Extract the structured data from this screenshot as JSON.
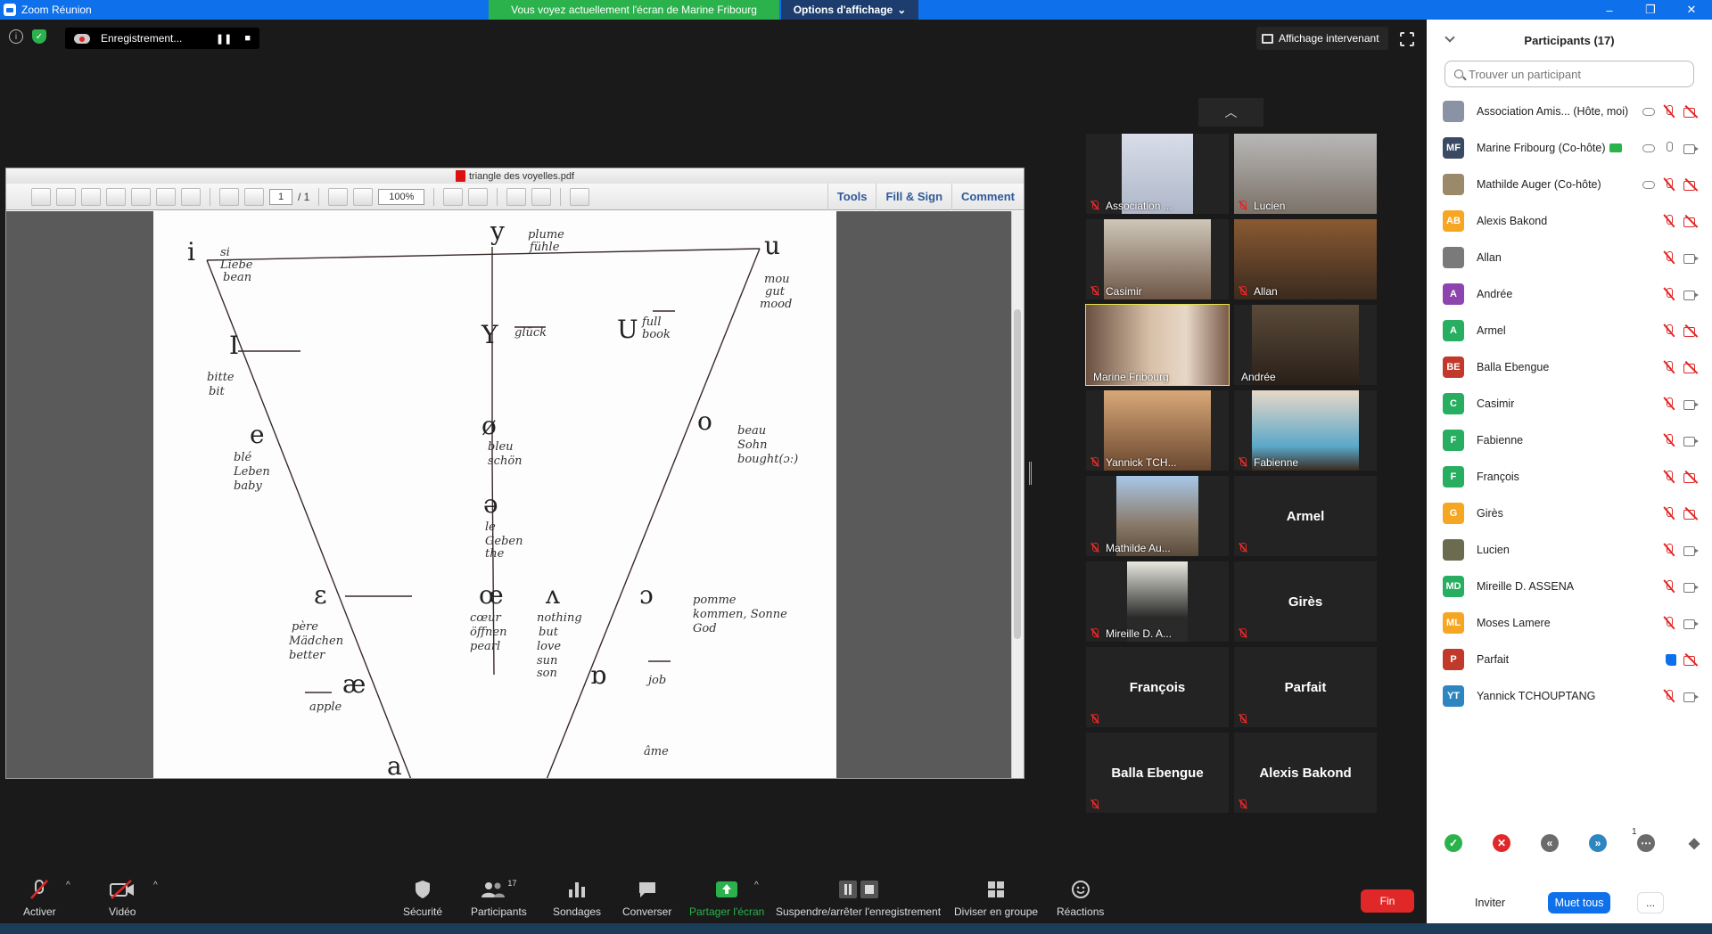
{
  "window": {
    "title": "Zoom Réunion",
    "share_banner": "Vous voyez actuellement l'écran de Marine Fribourg",
    "view_options": "Options d'affichage",
    "minimize": "–",
    "restore": "❐",
    "close": "✕"
  },
  "meeting_bar": {
    "recording_label": "Enregistrement...",
    "pause_glyph": "❚❚",
    "stop_glyph": "■",
    "speaker_view_label": "Affichage intervenant"
  },
  "pdf": {
    "filename": "triangle des voyelles.pdf",
    "page_current": "1",
    "page_total": "/ 1",
    "zoom": "100%",
    "tools": "Tools",
    "fill_sign": "Fill & Sign",
    "comment": "Comment"
  },
  "gallery": {
    "tiles": [
      {
        "name": "Association ..."
      },
      {
        "name": "Lucien"
      },
      {
        "name": "Casimir"
      },
      {
        "name": "Allan"
      },
      {
        "name": "Marine Fribourg"
      },
      {
        "name": "Andrée"
      },
      {
        "name": "Yannick TCH..."
      },
      {
        "name": "Fabienne"
      },
      {
        "name": "Mathilde Au..."
      },
      {
        "name": "Armel"
      },
      {
        "name": "Mireille D. A..."
      },
      {
        "name": "Girès"
      },
      {
        "name": "François"
      },
      {
        "name": "Parfait"
      },
      {
        "name": "Balla Ebengue"
      },
      {
        "name": "Alexis Bakond"
      }
    ]
  },
  "participants": {
    "title": "Participants (17)",
    "search_placeholder": "Trouver un participant",
    "list": [
      {
        "initials": "",
        "name": "Association Amis... (Hôte, moi)",
        "color": "#8a93a6"
      },
      {
        "initials": "MF",
        "name": "Marine Fribourg (Co-hôte)",
        "color": "#3b4a63"
      },
      {
        "initials": "",
        "name": "Mathilde Auger (Co-hôte)",
        "color": "#9a8a6a"
      },
      {
        "initials": "AB",
        "name": "Alexis Bakond",
        "color": "#f5a623"
      },
      {
        "initials": "",
        "name": "Allan",
        "color": "#7a7a7a"
      },
      {
        "initials": "A",
        "name": "Andrée",
        "color": "#8e44ad"
      },
      {
        "initials": "A",
        "name": "Armel",
        "color": "#27ae60"
      },
      {
        "initials": "BE",
        "name": "Balla Ebengue",
        "color": "#c0392b"
      },
      {
        "initials": "C",
        "name": "Casimir",
        "color": "#27ae60"
      },
      {
        "initials": "F",
        "name": "Fabienne",
        "color": "#27ae60"
      },
      {
        "initials": "F",
        "name": "François",
        "color": "#27ae60"
      },
      {
        "initials": "G",
        "name": "Girès",
        "color": "#f5a623"
      },
      {
        "initials": "",
        "name": "Lucien",
        "color": "#6b6b4f"
      },
      {
        "initials": "MD",
        "name": "Mireille D. ASSENA",
        "color": "#27ae60"
      },
      {
        "initials": "ML",
        "name": "Moses Lamere",
        "color": "#f5a623"
      },
      {
        "initials": "P",
        "name": "Parfait",
        "color": "#c0392b"
      },
      {
        "initials": "YT",
        "name": "Yannick TCHOUPTANG",
        "color": "#2e86c1"
      }
    ],
    "reaction_count": "1",
    "invite": "Inviter",
    "mute_all": "Muet tous",
    "more": "..."
  },
  "toolbar": {
    "unmute": "Activer",
    "video": "Vidéo",
    "security": "Sécurité",
    "participants": "Participants",
    "participants_count": "17",
    "polls": "Sondages",
    "chat": "Converser",
    "share": "Partager l'écran",
    "record": "Suspendre/arrêter l'enregistrement",
    "breakout": "Diviser en groupe",
    "reactions": "Réactions",
    "end": "Fin"
  },
  "colors": {
    "accent": "#0e71eb",
    "share_green": "#2bb24c",
    "danger": "#e02828"
  }
}
